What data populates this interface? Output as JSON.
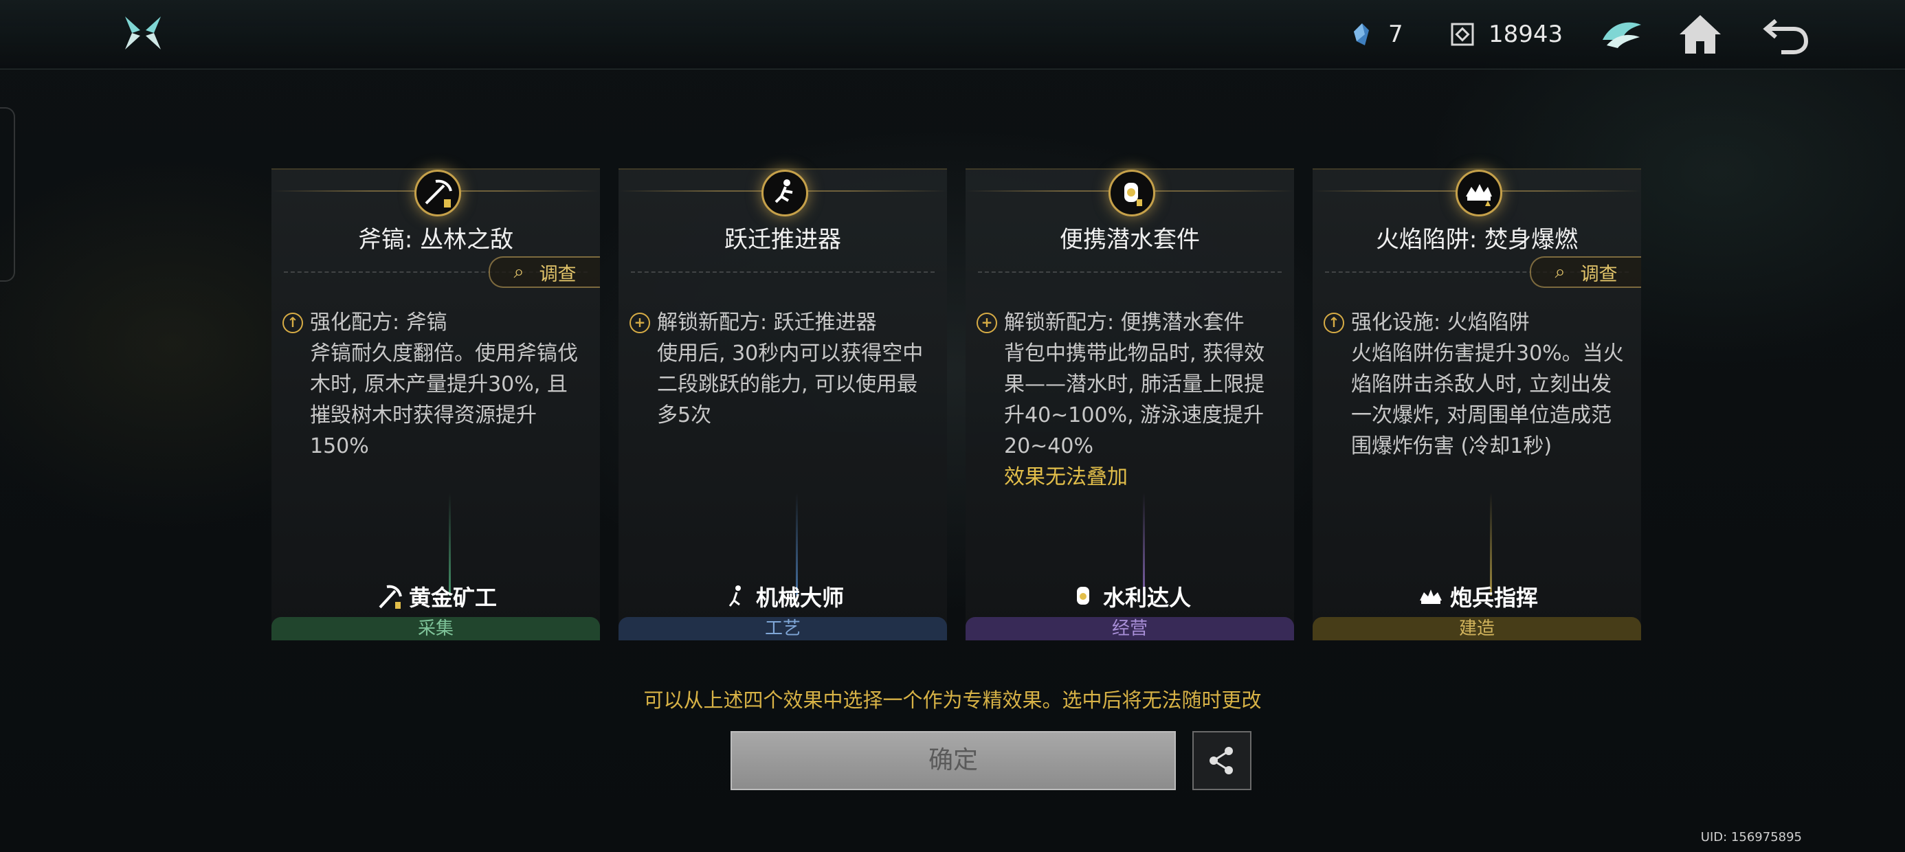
{
  "topbar": {
    "logo_icon": "game-logo-icon",
    "ore_count": "7",
    "coin_count": "18943",
    "icons": [
      "wing-helmet-icon",
      "home-icon",
      "back-icon"
    ]
  },
  "cards": [
    {
      "icon": "pickaxe-icon",
      "title": "斧镐: 丛林之敌",
      "investigate": "调查",
      "line1": "强化配方: 斧镐",
      "body": "斧镐耐久度翻倍。使用斧镐伐木时, 原木产量提升30%, 且摧毁树木时获得资源提升150%",
      "warn": "",
      "role": "黄金矿工",
      "category": "采集",
      "accent": "#3d8f5e"
    },
    {
      "icon": "jumper-icon",
      "title": "跃迁推进器",
      "investigate": "",
      "line1": "解锁新配方: 跃迁推进器",
      "body": "使用后, 30秒内可以获得空中二段跳跃的能力, 可以使用最多5次",
      "warn": "",
      "role": "机械大师",
      "category": "工艺",
      "accent": "#3c6aa0"
    },
    {
      "icon": "diving-kit-icon",
      "title": "便携潜水套件",
      "investigate": "",
      "line1": "解锁新配方: 便携潜水套件",
      "body": "背包中携带此物品时, 获得效果——潜水时, 肺活量上限提升40~100%, 游泳速度提升20~40%",
      "warn": "效果无法叠加",
      "role": "水利达人",
      "category": "经营",
      "accent": "#6a4f9c"
    },
    {
      "icon": "fire-trap-icon",
      "title": "火焰陷阱: 焚身爆燃",
      "investigate": "调查",
      "line1": "强化设施: 火焰陷阱",
      "body": "火焰陷阱伤害提升30%。当火焰陷阱击杀敌人时, 立刻出发一次爆炸, 对周围单位造成范围爆炸伤害 (冷却1秒)",
      "warn": "",
      "role": "炮兵指挥",
      "category": "建造",
      "accent": "#8f7a2c"
    }
  ],
  "hint": "可以从上述四个效果中选择一个作为专精效果。选中后将无法随时更改",
  "confirm_label": "确定",
  "uid": "UID: 156975895"
}
